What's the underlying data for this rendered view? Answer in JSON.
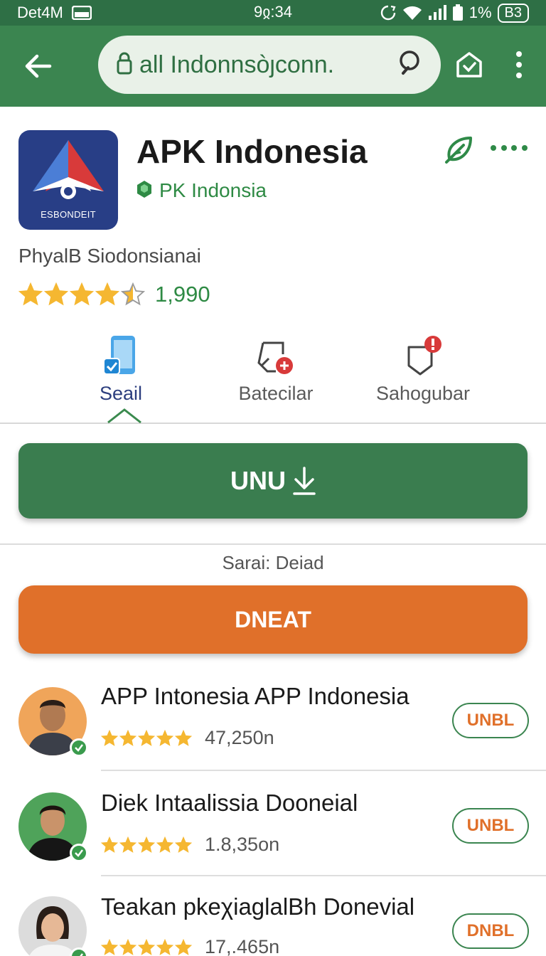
{
  "status_bar": {
    "carrier": "Det4M",
    "time": "9ჲ:34",
    "battery": "1%",
    "battery_badge": "B3"
  },
  "browser": {
    "url": "all Indonnsòȷconn."
  },
  "app": {
    "title": "APK Indonesia",
    "developer": "PK Indonsia",
    "icon_label": "ESBONDEIT",
    "subtitle": "PhyalB Siodonsianai",
    "rating": 4.5,
    "rating_count": "1,990"
  },
  "tabs": [
    {
      "label": "Seail",
      "icon": "phone-check-icon",
      "active": true
    },
    {
      "label": "Batecilar",
      "icon": "broken-link-icon",
      "active": false
    },
    {
      "label": "Sahogubar",
      "icon": "shield-alert-icon",
      "active": false
    }
  ],
  "install_button": {
    "label": "UNU"
  },
  "status_caption": "Sarai: Deiad",
  "secondary_button": {
    "label": "DNEAT"
  },
  "list": [
    {
      "title": "APP Intonesia APP Indonesia",
      "rating": 5,
      "count": "47,250n",
      "button": "UNBL",
      "avatar_bg": "#f0a55a"
    },
    {
      "title": "Diek Intaalissia Dooneial",
      "rating": 5,
      "count": "1.8,35on",
      "button": "UNBL",
      "avatar_bg": "#4fa35a"
    },
    {
      "title": "Teakan pkeχiaglalBh Donevial",
      "rating": 5,
      "count": "17,.465n",
      "button": "DNBL",
      "avatar_bg": "#dcdcdc"
    }
  ],
  "colors": {
    "brand_green": "#3b8550",
    "status_green": "#2e6f45",
    "accent_orange": "#e0702a",
    "star": "#f5b731",
    "icon_bg": "#283e86"
  }
}
